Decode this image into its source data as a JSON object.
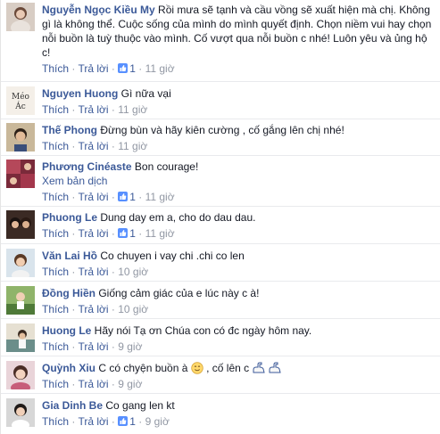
{
  "comments": [
    {
      "author": "Nguyễn Ngọc Kiều My",
      "text": "Rồi mưa sẽ tạnh và cầu vồng sẽ xuất hiện mà chị. Không gì là không thể. Cuộc sống của mình do mình quyết định. Chọn niềm vui hay chọn nỗi buồn là tuỳ thuộc vào mình. Cố vượt qua nỗi buồn c nhé! Luôn yêu và ủng hộ c!",
      "like_label": "Thích",
      "reply_label": "Trả lời",
      "like_count": "1",
      "time": "11 giờ"
    },
    {
      "author": "Nguyen Huong",
      "text": "Gì nữa vại",
      "like_label": "Thích",
      "reply_label": "Trả lời",
      "time": "11 giờ",
      "avatar_text": "Méo Ác"
    },
    {
      "author": "Thế Phong",
      "text": "Đừng bùn và hãy kiên cường , cố gắng lên chị nhé!",
      "like_label": "Thích",
      "reply_label": "Trả lời",
      "time": "11 giờ"
    },
    {
      "author": "Phương Cinéaste",
      "text": "Bon courage!",
      "translate_label": "Xem bản dịch",
      "like_label": "Thích",
      "reply_label": "Trả lời",
      "like_count": "1",
      "time": "11 giờ"
    },
    {
      "author": "Phuong Le",
      "text": "Dung day em a, cho do dau dau.",
      "like_label": "Thích",
      "reply_label": "Trả lời",
      "like_count": "1",
      "time": "11 giờ"
    },
    {
      "author": "Văn Lai Hồ",
      "text": "Co chuyen i vay chi .chi co len",
      "like_label": "Thích",
      "reply_label": "Trả lời",
      "time": "10 giờ"
    },
    {
      "author": "Đồng Hiền",
      "text": "Giống cảm giác của e lúc này c à!",
      "like_label": "Thích",
      "reply_label": "Trả lời",
      "time": "10 giờ"
    },
    {
      "author": "Huong Le",
      "text": "Hãy nói Tạ ơn Chúa con có đc ngày hôm nay.",
      "like_label": "Thích",
      "reply_label": "Trả lời",
      "time": "9 giờ"
    },
    {
      "author": "Quỳnh Xiu",
      "text": "C có chyện buồn à",
      "text_after": ", cố lên c",
      "like_label": "Thích",
      "reply_label": "Trả lời",
      "time": "9 giờ"
    },
    {
      "author": "Gia Dinh Be",
      "text": "Co gang len kt",
      "like_label": "Thích",
      "reply_label": "Trả lời",
      "like_count": "1",
      "time": "9 giờ"
    }
  ],
  "icons": {
    "like": "thumbs-up-icon",
    "smile": "smile-emoji-icon",
    "strong": "flexed-arm-emoji-icon"
  },
  "colors": {
    "link": "#3b5998",
    "muted": "#9197a3",
    "text": "#141823",
    "divider": "#e9eaed"
  }
}
